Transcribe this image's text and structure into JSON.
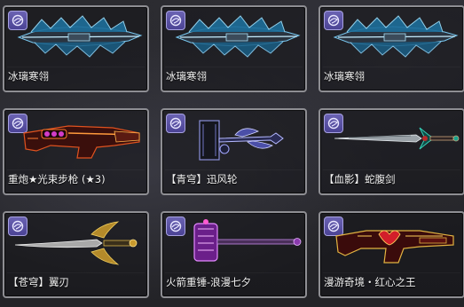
{
  "items": [
    {
      "name": "冰璃寒翎",
      "weapon_icon": "ice-feather-gun-icon"
    },
    {
      "name": "冰璃寒翎",
      "weapon_icon": "ice-feather-gun-icon"
    },
    {
      "name": "冰璃寒翎",
      "weapon_icon": "ice-feather-gun-icon"
    },
    {
      "name": "重炮★光束步枪 (★3)",
      "weapon_icon": "beam-rifle-icon"
    },
    {
      "name": "【青穹】迅风轮",
      "weapon_icon": "wind-wheel-icon"
    },
    {
      "name": "【血影】蛇腹剑",
      "weapon_icon": "serpent-sword-icon"
    },
    {
      "name": "【苍穹】翼刃",
      "weapon_icon": "wing-blade-icon"
    },
    {
      "name": "火箭重锤-浪漫七夕",
      "weapon_icon": "rocket-hammer-icon"
    },
    {
      "name": "漫游奇境・红心之王",
      "weapon_icon": "heart-king-rifle-icon"
    }
  ],
  "badge_icon": "cosmic-orb-icon",
  "colors": {
    "border": "#8e8e93",
    "badge": "#5b53a5",
    "label": "#f2f2f2",
    "background": "#2a2a2e"
  }
}
